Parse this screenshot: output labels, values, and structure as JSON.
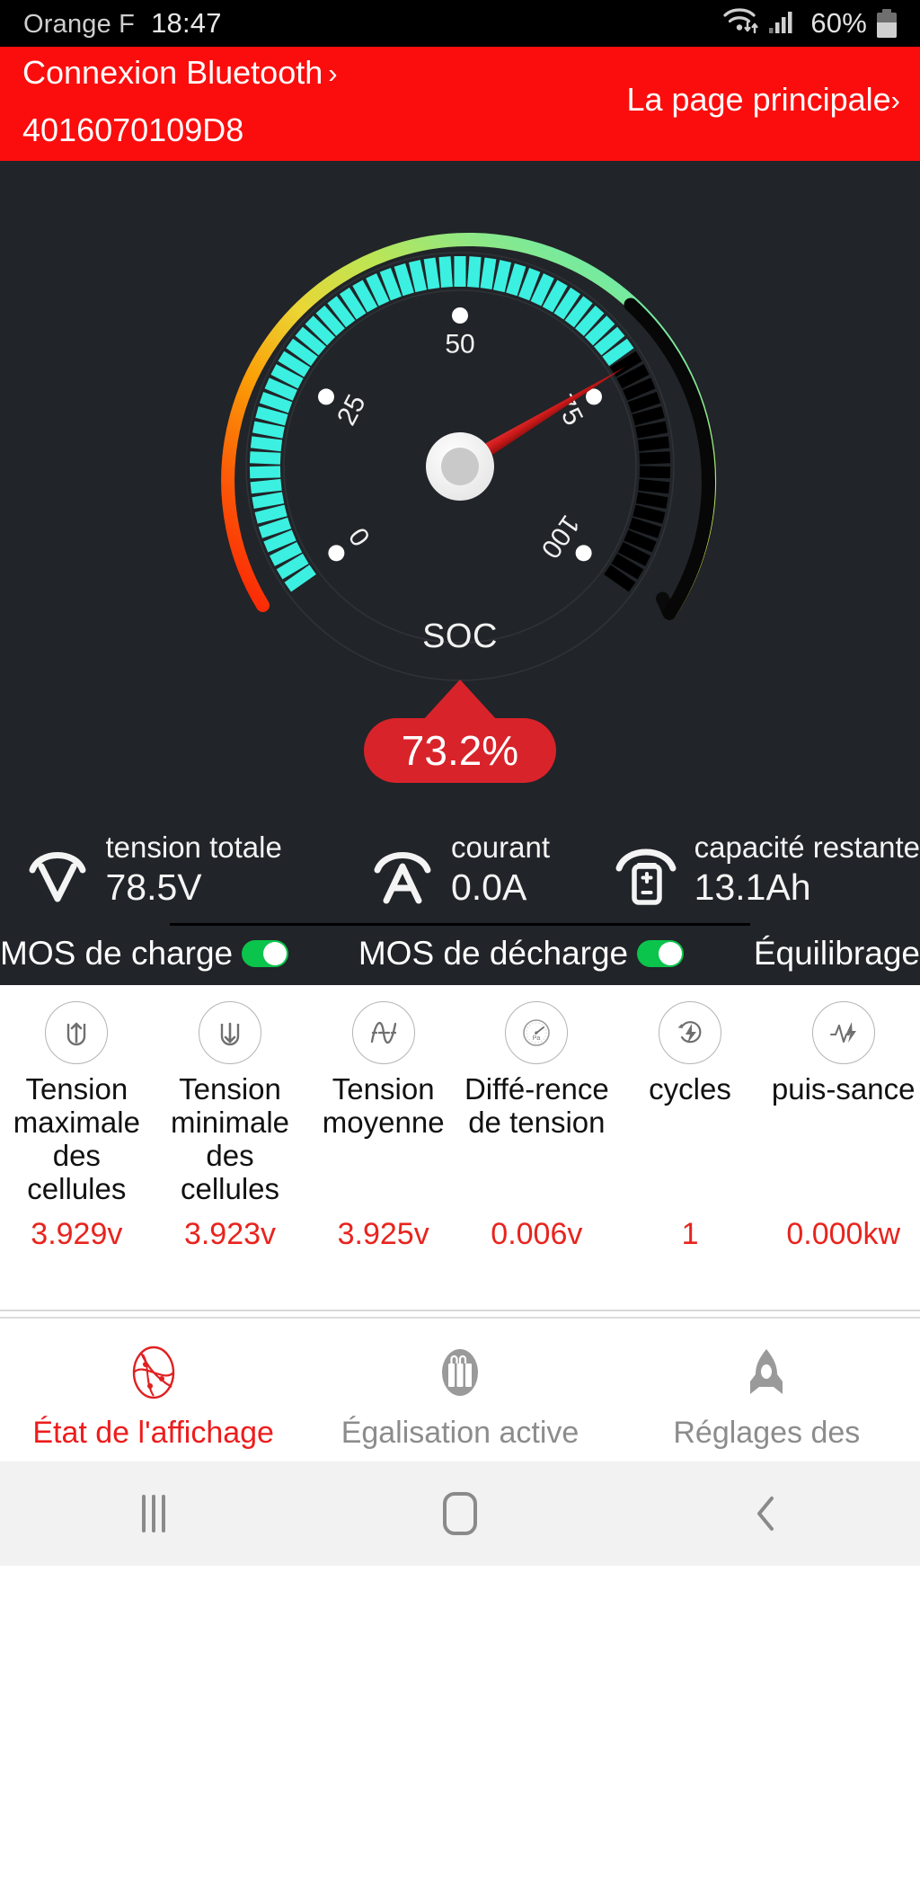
{
  "status_bar": {
    "carrier": "Orange F",
    "time": "18:47",
    "battery_percent": "60%",
    "icons": [
      "wifi-icon",
      "signal-bars-icon",
      "battery-icon"
    ]
  },
  "header": {
    "bluetooth_label": "Connexion Bluetooth",
    "bluetooth_chevron": "›",
    "device_id": "4016070109D8",
    "main_page_label": "La page principale",
    "main_page_chevron": "›",
    "background_color": "#fb0d0d"
  },
  "gauge": {
    "title": "SOC",
    "value_label": "73.2%",
    "value": 73.2,
    "min": 0,
    "max": 100,
    "tick_labels": [
      "0",
      "25",
      "50",
      "75",
      "100"
    ],
    "active_color": "#3bf0e0",
    "inactive_color": "#000000",
    "needle_color": "#c31111",
    "badge_color": "#d8232a",
    "background_color": "#212428"
  },
  "metrics": [
    {
      "icon": "voltmeter-icon",
      "name": "tension totale",
      "value": "78.5V"
    },
    {
      "icon": "ammeter-icon",
      "name": "courant",
      "value": "0.0A"
    },
    {
      "icon": "battery-capacity-icon",
      "name": "capacité restante",
      "value": "13.1Ah"
    }
  ],
  "mos_row": [
    {
      "label": "MOS de charge",
      "state": "on",
      "color": "#0bc44b"
    },
    {
      "label": "MOS de décharge",
      "state": "on",
      "color": "#0bc44b"
    },
    {
      "label": "Équilibrage",
      "state": "none"
    }
  ],
  "cell_stats": {
    "value_color": "#e8241e",
    "columns": [
      {
        "icon": "voltage-up-icon",
        "label": "Tension maximale des cellules",
        "value": "3.929v"
      },
      {
        "icon": "voltage-down-icon",
        "label": "Tension minimale des cellules",
        "value": "3.923v"
      },
      {
        "icon": "voltage-average-icon",
        "label": "Tension moyenne",
        "value": "3.925v"
      },
      {
        "icon": "pressure-gauge-icon",
        "label": "Diffé-rence de tension",
        "value": "0.006v"
      },
      {
        "icon": "cycle-icon",
        "label": "cycles",
        "value": "1"
      },
      {
        "icon": "power-pulse-icon",
        "label": "puis-sance",
        "value": "0.000kw"
      }
    ]
  },
  "tabs": [
    {
      "icon": "globe-status-icon",
      "label": "État de l'affichage",
      "active": true,
      "color": "#ee1c1c"
    },
    {
      "icon": "balance-cells-icon",
      "label": "Égalisation active",
      "active": false,
      "color": "#8c8c8c"
    },
    {
      "icon": "settings-rocket-icon",
      "label": "Réglages des",
      "active": false,
      "color": "#8c8c8c"
    }
  ],
  "nav_bar": {
    "recents": "recents-icon",
    "home": "home-icon",
    "back": "back-icon",
    "back_glyph": "‹"
  }
}
